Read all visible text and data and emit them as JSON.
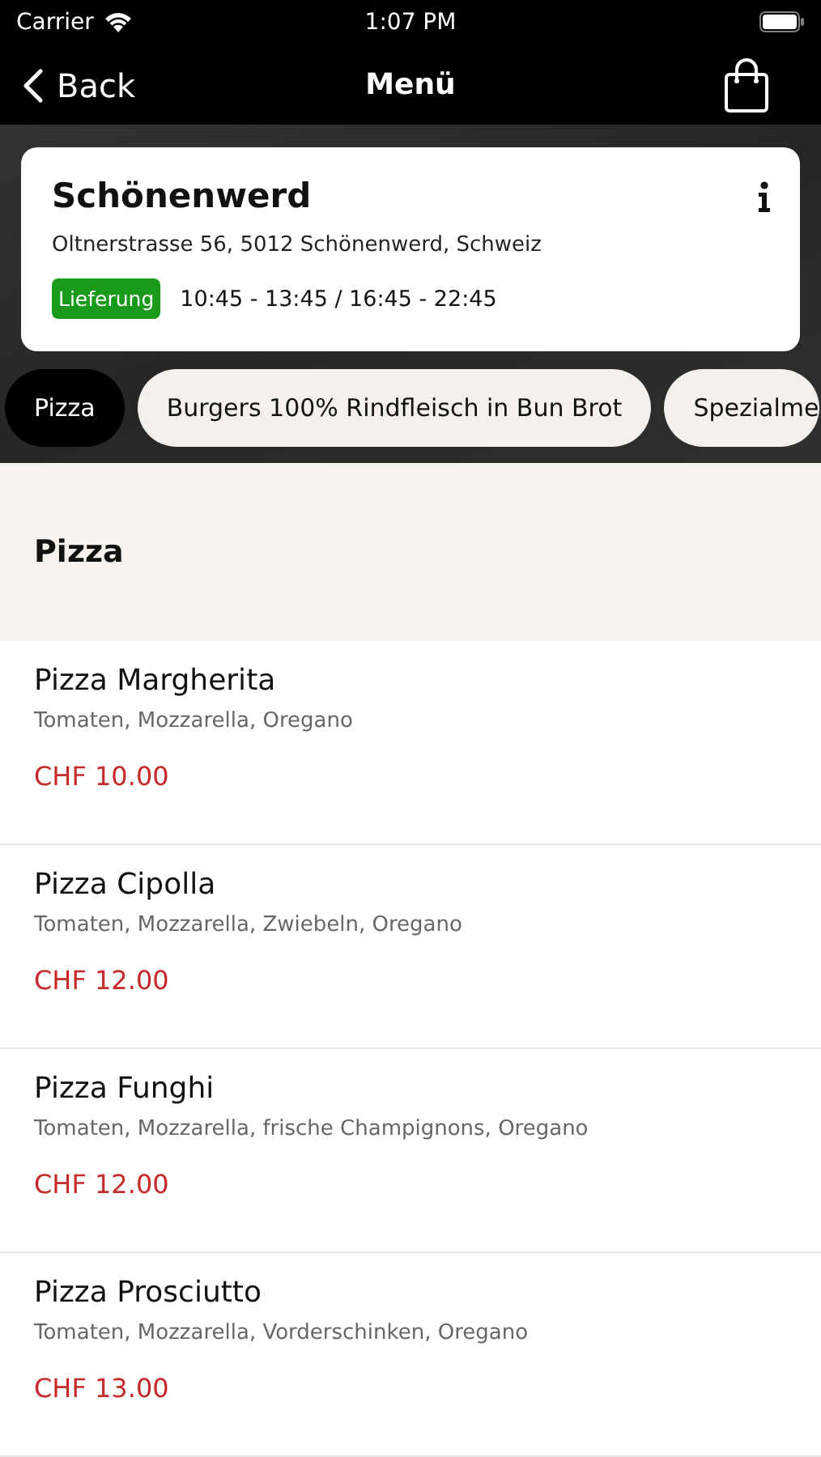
{
  "status_bar": {
    "carrier": "Carrier",
    "time": "1:07 PM"
  },
  "nav": {
    "back": "Back",
    "title": "Menü"
  },
  "store": {
    "name": "Schönenwerd",
    "address": "Oltnerstrasse 56, 5012 Schönenwerd, Schweiz",
    "mode": "Lieferung",
    "hours": "10:45 - 13:45 / 16:45 - 22:45"
  },
  "categories": [
    {
      "label": "Pizza",
      "selected": true
    },
    {
      "label": "Burgers 100% Rindfleisch in Bun Brot",
      "selected": false
    },
    {
      "label": "Spezialme",
      "selected": false
    }
  ],
  "section": {
    "title": "Pizza"
  },
  "items": [
    {
      "name": "Pizza Margherita",
      "description": "Tomaten, Mozzarella, Oregano",
      "price": "CHF 10.00"
    },
    {
      "name": "Pizza Cipolla",
      "description": "Tomaten, Mozzarella, Zwiebeln, Oregano",
      "price": "CHF 12.00"
    },
    {
      "name": "Pizza Funghi",
      "description": "Tomaten, Mozzarella, frische Champignons, Oregano",
      "price": "CHF 12.00"
    },
    {
      "name": "Pizza Prosciutto",
      "description": "Tomaten, Mozzarella, Vorderschinken, Oregano",
      "price": "CHF 13.00"
    }
  ]
}
